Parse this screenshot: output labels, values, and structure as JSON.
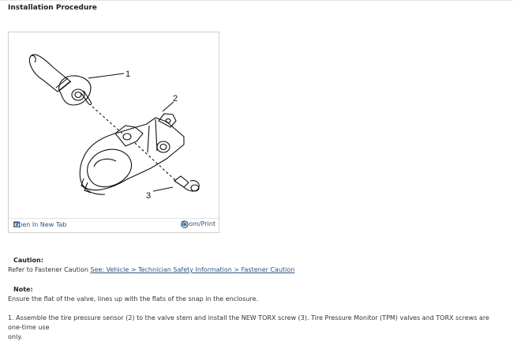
{
  "page": {
    "heading": "Installation Procedure"
  },
  "figure": {
    "callouts": [
      "1",
      "2",
      "3"
    ],
    "open_tab_label": "Open In New Tab",
    "zoom_label": "Zoom/Print"
  },
  "caution": {
    "title": "Caution:",
    "text": "Refer to Fastener Caution ",
    "link": "See: Vehicle > Technician Safety Information > Fastener Caution"
  },
  "note": {
    "title": "Note:",
    "text": "Ensure the flat of the valve, lines up with the flats of the snap in the enclosure."
  },
  "step": {
    "text_line1": "1. Assemble the tire pressure sensor (2) to the valve stem and install the NEW TORX screw (3). Tire Pressure Monitor (TPM) valves and TORX screws are one-time use",
    "text_line2": "only."
  },
  "colors": {
    "link": "#2a5586",
    "text": "#222222"
  }
}
